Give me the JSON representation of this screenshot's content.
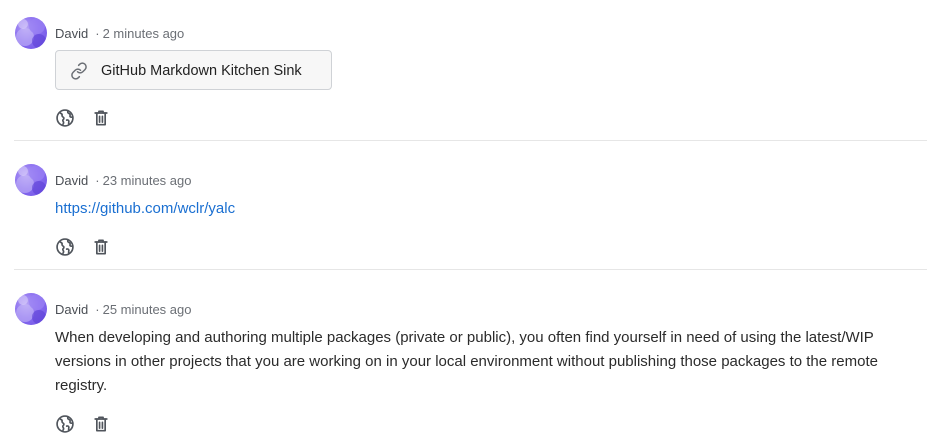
{
  "colors": {
    "link": "#1a6fd1",
    "avatar_accent": "#7b5cf0",
    "divider": "#e6e6e6",
    "icon": "#555a61"
  },
  "posts": [
    {
      "author": "David",
      "separator": "·",
      "time": "2 minutes ago",
      "type": "link-card",
      "link_title": "GitHub Markdown Kitchen Sink",
      "link_icon": "link-icon",
      "actions": [
        "globe-icon",
        "trash-icon"
      ]
    },
    {
      "author": "David",
      "separator": "·",
      "time": "23 minutes ago",
      "type": "url",
      "url_text": "https://github.com/wclr/yalc",
      "actions": [
        "globe-icon",
        "trash-icon"
      ]
    },
    {
      "author": "David",
      "separator": "·",
      "time": "25 minutes ago",
      "type": "text",
      "body": "When developing and authoring multiple packages (private or public), you often find yourself in need of using the latest/WIP versions in other projects that you are working on in your local environment without publishing those packages to the remote registry.",
      "actions": [
        "globe-icon",
        "trash-icon"
      ]
    }
  ]
}
